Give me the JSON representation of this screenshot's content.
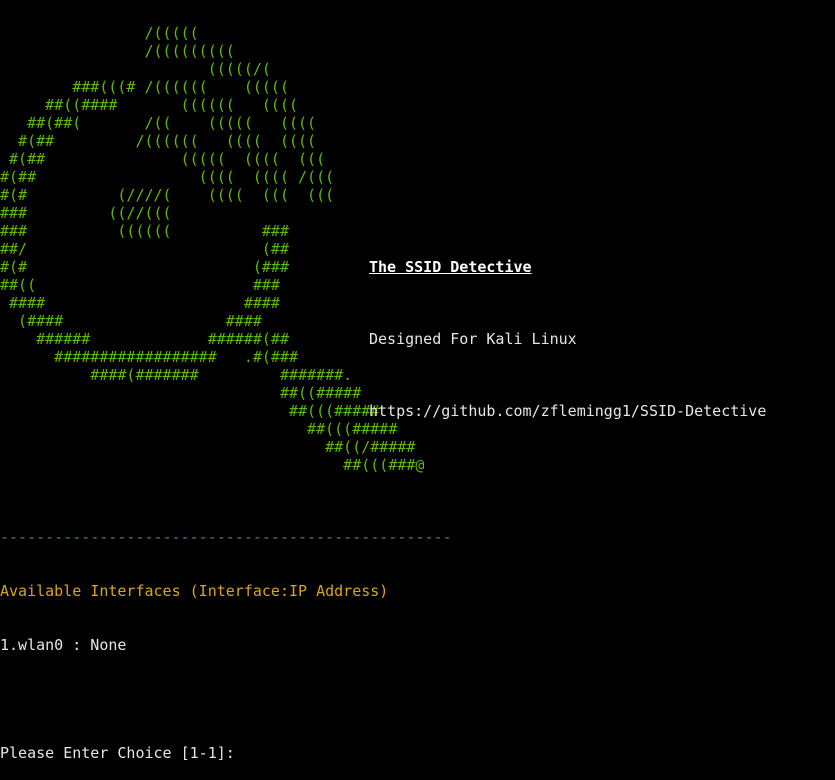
{
  "colors": {
    "background": "#000000",
    "art": "#5fb80a",
    "text": "#e6e6e6",
    "divider": "#3f7fa0",
    "heading": "#d9a520"
  },
  "art_lines": [
    "                /(((((",
    "                /(((((((((",
    "                       (((((/(",
    "        ###(((# /((((((    (((((",
    "     ##((####       ((((((   ((((",
    "   ##(##(       /((    (((((   ((((",
    "  #(##         /((((((   ((((  ((((",
    " #(##               (((((  ((((  (((",
    "#(##                  ((((  (((( /(((",
    "#(#          (////(    ((((  (((  (((",
    "###         ((//(((",
    "###          ((((((          ###",
    "##/                          (##",
    "#(#                         (###",
    "##((                        ###",
    " ####                      ####",
    "  (####                  ####",
    "    ######             ######(##",
    "      ##################   .#(###",
    "          ####(#######         #######.",
    "                               ##((#####",
    "                                ##(((#####",
    "                                  ##(((#####",
    "                                    ##((/#####",
    "                                      ##(((###@"
  ],
  "info": {
    "title": "The SSID Detective",
    "subtitle": "Designed For Kali Linux",
    "url": "https://github.com/zflemingg1/SSID-Detective"
  },
  "bottom": {
    "divider": "--------------------------------------------------",
    "interfaces_heading": "Available Interfaces (Interface:IP Address)",
    "interfaces": [
      "1.wlan0 : None"
    ],
    "prompt": "Please Enter Choice [1-1]:"
  }
}
